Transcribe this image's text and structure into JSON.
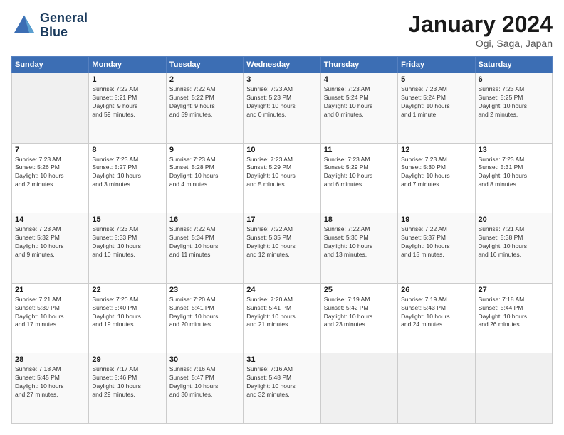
{
  "header": {
    "logo_line1": "General",
    "logo_line2": "Blue",
    "title": "January 2024",
    "subtitle": "Ogi, Saga, Japan"
  },
  "calendar": {
    "days_of_week": [
      "Sunday",
      "Monday",
      "Tuesday",
      "Wednesday",
      "Thursday",
      "Friday",
      "Saturday"
    ],
    "weeks": [
      [
        {
          "day": "",
          "info": ""
        },
        {
          "day": "1",
          "info": "Sunrise: 7:22 AM\nSunset: 5:21 PM\nDaylight: 9 hours\nand 59 minutes."
        },
        {
          "day": "2",
          "info": "Sunrise: 7:22 AM\nSunset: 5:22 PM\nDaylight: 9 hours\nand 59 minutes."
        },
        {
          "day": "3",
          "info": "Sunrise: 7:23 AM\nSunset: 5:23 PM\nDaylight: 10 hours\nand 0 minutes."
        },
        {
          "day": "4",
          "info": "Sunrise: 7:23 AM\nSunset: 5:24 PM\nDaylight: 10 hours\nand 0 minutes."
        },
        {
          "day": "5",
          "info": "Sunrise: 7:23 AM\nSunset: 5:24 PM\nDaylight: 10 hours\nand 1 minute."
        },
        {
          "day": "6",
          "info": "Sunrise: 7:23 AM\nSunset: 5:25 PM\nDaylight: 10 hours\nand 2 minutes."
        }
      ],
      [
        {
          "day": "7",
          "info": "Sunrise: 7:23 AM\nSunset: 5:26 PM\nDaylight: 10 hours\nand 2 minutes."
        },
        {
          "day": "8",
          "info": "Sunrise: 7:23 AM\nSunset: 5:27 PM\nDaylight: 10 hours\nand 3 minutes."
        },
        {
          "day": "9",
          "info": "Sunrise: 7:23 AM\nSunset: 5:28 PM\nDaylight: 10 hours\nand 4 minutes."
        },
        {
          "day": "10",
          "info": "Sunrise: 7:23 AM\nSunset: 5:29 PM\nDaylight: 10 hours\nand 5 minutes."
        },
        {
          "day": "11",
          "info": "Sunrise: 7:23 AM\nSunset: 5:29 PM\nDaylight: 10 hours\nand 6 minutes."
        },
        {
          "day": "12",
          "info": "Sunrise: 7:23 AM\nSunset: 5:30 PM\nDaylight: 10 hours\nand 7 minutes."
        },
        {
          "day": "13",
          "info": "Sunrise: 7:23 AM\nSunset: 5:31 PM\nDaylight: 10 hours\nand 8 minutes."
        }
      ],
      [
        {
          "day": "14",
          "info": "Sunrise: 7:23 AM\nSunset: 5:32 PM\nDaylight: 10 hours\nand 9 minutes."
        },
        {
          "day": "15",
          "info": "Sunrise: 7:23 AM\nSunset: 5:33 PM\nDaylight: 10 hours\nand 10 minutes."
        },
        {
          "day": "16",
          "info": "Sunrise: 7:22 AM\nSunset: 5:34 PM\nDaylight: 10 hours\nand 11 minutes."
        },
        {
          "day": "17",
          "info": "Sunrise: 7:22 AM\nSunset: 5:35 PM\nDaylight: 10 hours\nand 12 minutes."
        },
        {
          "day": "18",
          "info": "Sunrise: 7:22 AM\nSunset: 5:36 PM\nDaylight: 10 hours\nand 13 minutes."
        },
        {
          "day": "19",
          "info": "Sunrise: 7:22 AM\nSunset: 5:37 PM\nDaylight: 10 hours\nand 15 minutes."
        },
        {
          "day": "20",
          "info": "Sunrise: 7:21 AM\nSunset: 5:38 PM\nDaylight: 10 hours\nand 16 minutes."
        }
      ],
      [
        {
          "day": "21",
          "info": "Sunrise: 7:21 AM\nSunset: 5:39 PM\nDaylight: 10 hours\nand 17 minutes."
        },
        {
          "day": "22",
          "info": "Sunrise: 7:20 AM\nSunset: 5:40 PM\nDaylight: 10 hours\nand 19 minutes."
        },
        {
          "day": "23",
          "info": "Sunrise: 7:20 AM\nSunset: 5:41 PM\nDaylight: 10 hours\nand 20 minutes."
        },
        {
          "day": "24",
          "info": "Sunrise: 7:20 AM\nSunset: 5:41 PM\nDaylight: 10 hours\nand 21 minutes."
        },
        {
          "day": "25",
          "info": "Sunrise: 7:19 AM\nSunset: 5:42 PM\nDaylight: 10 hours\nand 23 minutes."
        },
        {
          "day": "26",
          "info": "Sunrise: 7:19 AM\nSunset: 5:43 PM\nDaylight: 10 hours\nand 24 minutes."
        },
        {
          "day": "27",
          "info": "Sunrise: 7:18 AM\nSunset: 5:44 PM\nDaylight: 10 hours\nand 26 minutes."
        }
      ],
      [
        {
          "day": "28",
          "info": "Sunrise: 7:18 AM\nSunset: 5:45 PM\nDaylight: 10 hours\nand 27 minutes."
        },
        {
          "day": "29",
          "info": "Sunrise: 7:17 AM\nSunset: 5:46 PM\nDaylight: 10 hours\nand 29 minutes."
        },
        {
          "day": "30",
          "info": "Sunrise: 7:16 AM\nSunset: 5:47 PM\nDaylight: 10 hours\nand 30 minutes."
        },
        {
          "day": "31",
          "info": "Sunrise: 7:16 AM\nSunset: 5:48 PM\nDaylight: 10 hours\nand 32 minutes."
        },
        {
          "day": "",
          "info": ""
        },
        {
          "day": "",
          "info": ""
        },
        {
          "day": "",
          "info": ""
        }
      ]
    ]
  }
}
